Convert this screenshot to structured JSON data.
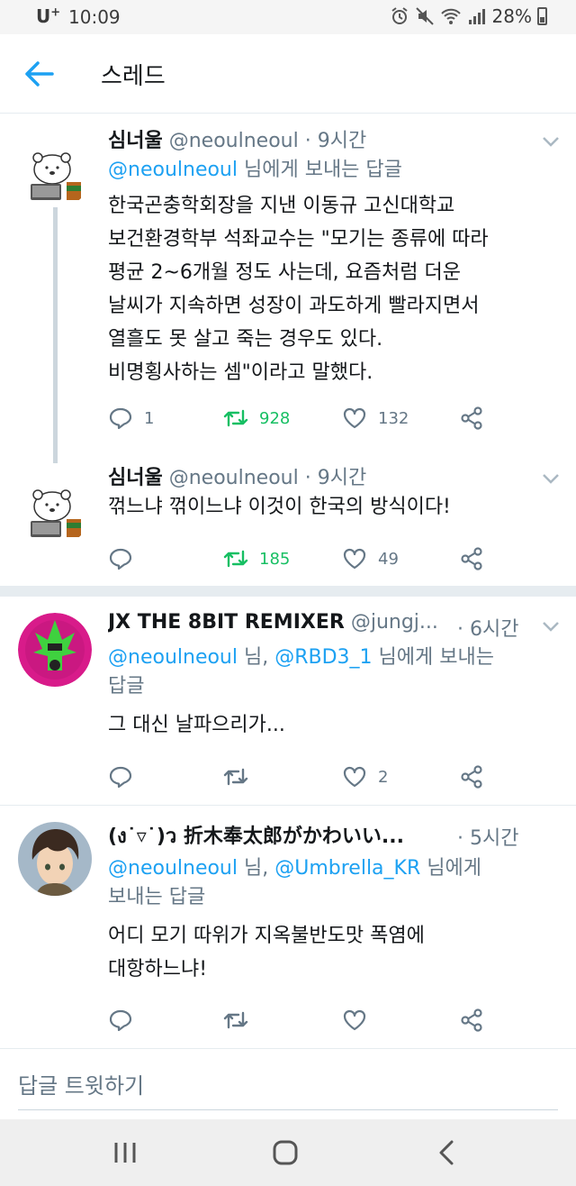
{
  "status_bar": {
    "carrier": "U",
    "carrier_sup": "+",
    "time": "10:09",
    "battery": "28%"
  },
  "header": {
    "title": "스레드",
    "back_icon": "arrow-left-icon"
  },
  "tweets": [
    {
      "name": "심너울",
      "handle": "@neoulneoul",
      "sep": "·",
      "time": "9시간",
      "reply_to_link": "@neoulneoul",
      "reply_to_suffix": " 님에게 보내는 답글",
      "body_lines": [
        "한국곤충학회장을 지낸 이동규 고신대학교",
        "보건환경학부 석좌교수는 \"모기는 종류에 따라",
        "평균 2~6개월 정도 사는데, 요즘처럼 더운",
        "날씨가 지속하면 성장이 과도하게 빨라지면서",
        "열흘도 못 살고 죽는 경우도 있다.",
        "비명횡사하는 셈\"이라고 말했다."
      ],
      "replies": "1",
      "retweets": "928",
      "likes": "132"
    },
    {
      "name": "심너울",
      "handle": "@neoulneoul",
      "sep": "·",
      "time": "9시간",
      "body_lines": [
        "꺾느냐 꺾이느냐 이것이 한국의 방식이다!"
      ],
      "replies": "",
      "retweets": "185",
      "likes": "49"
    },
    {
      "name": "JX THE 8BIT REMIXER",
      "handle": "@jungj...",
      "sep": "·",
      "time": "6시간",
      "reply_to_link1": "@neoulneoul",
      "reply_to_mid": " 님, ",
      "reply_to_link2": "@RBD3_1",
      "reply_to_suffix1": " 님에게 보내는",
      "reply_to_suffix2": "답글",
      "body_lines": [
        "그 대신 날파으리가..."
      ],
      "replies": "",
      "retweets": "",
      "likes": "2"
    },
    {
      "name": "(ง˙▿˙)ว 折木奉太郎がかわいい...",
      "sep": "·",
      "time": "5시간",
      "reply_to_link1": "@neoulneoul",
      "reply_to_mid": " 님, ",
      "reply_to_link2": "@Umbrella_KR",
      "reply_to_suffix1": " 님에게",
      "reply_to_suffix2": "보내는 답글",
      "body_lines": [
        "어디 모기 따위가 지옥불반도맛 폭염에",
        "대항하느냐!"
      ],
      "replies": "",
      "retweets": "",
      "likes": ""
    }
  ],
  "composer": {
    "placeholder": "답글 트윗하기"
  },
  "colors": {
    "accent": "#1da1f2",
    "retweet": "#17bf63",
    "muted": "#657786"
  }
}
